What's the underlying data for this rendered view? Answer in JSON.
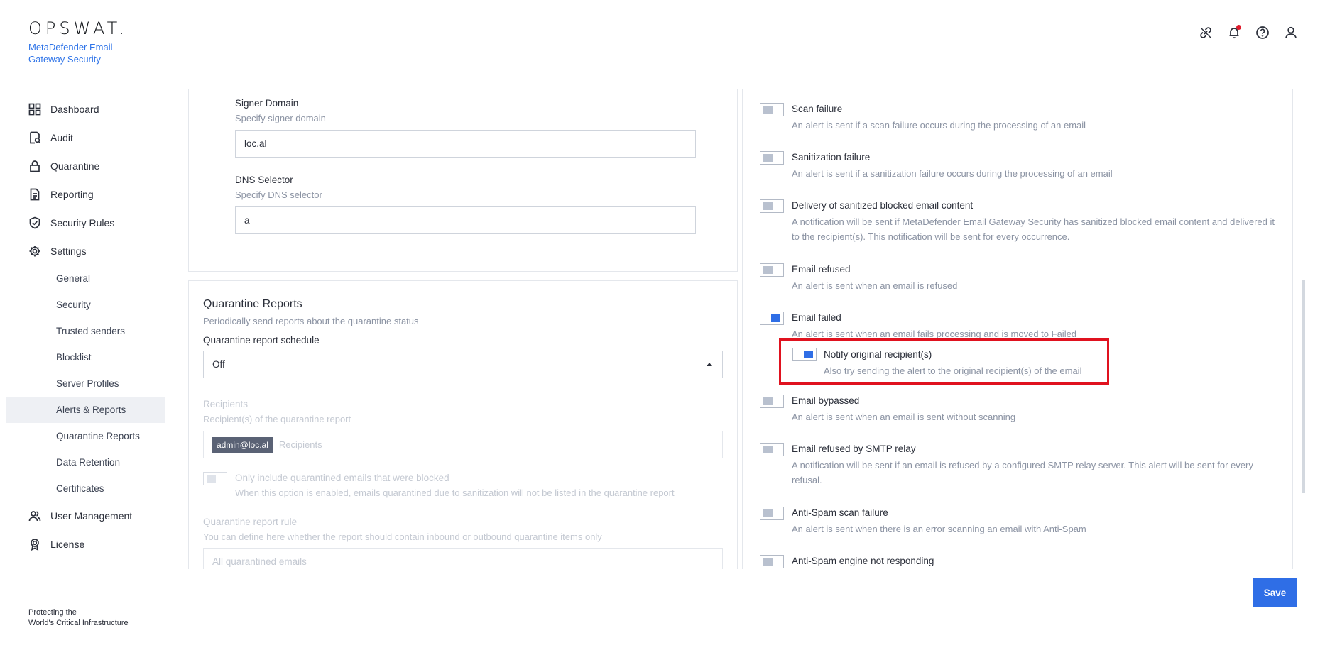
{
  "brand": {
    "logo": "OPSWAT.",
    "product": "MetaDefender Email Gateway Security"
  },
  "header_icons": [
    "link-icon",
    "bell-icon",
    "help-icon",
    "user-icon"
  ],
  "sidebar": {
    "items": [
      {
        "label": "Dashboard",
        "icon": "dashboard-icon"
      },
      {
        "label": "Audit",
        "icon": "audit-icon"
      },
      {
        "label": "Quarantine",
        "icon": "lock-icon"
      },
      {
        "label": "Reporting",
        "icon": "document-icon"
      },
      {
        "label": "Security Rules",
        "icon": "shield-icon"
      },
      {
        "label": "Settings",
        "icon": "gear-icon"
      }
    ],
    "settings_sub": [
      "General",
      "Security",
      "Trusted senders",
      "Blocklist",
      "Server Profiles",
      "Alerts & Reports",
      "Quarantine Reports",
      "Data Retention",
      "Certificates"
    ],
    "active_sub": "Alerts & Reports",
    "bottom_items": [
      {
        "label": "User Management",
        "icon": "users-icon"
      },
      {
        "label": "License",
        "icon": "award-icon"
      }
    ],
    "footer_line1": "Protecting the",
    "footer_line2": "World's Critical Infrastructure"
  },
  "dkim": {
    "signer_domain_label": "Signer Domain",
    "signer_domain_hint": "Specify signer domain",
    "signer_domain_value": "loc.al",
    "dns_selector_label": "DNS Selector",
    "dns_selector_hint": "Specify DNS selector",
    "dns_selector_value": "a"
  },
  "quarantine_reports": {
    "title": "Quarantine Reports",
    "subtitle": "Periodically send reports about the quarantine status",
    "schedule_label": "Quarantine report schedule",
    "schedule_value": "Off",
    "recipients_label": "Recipients",
    "recipients_hint": "Recipient(s) of the quarantine report",
    "recipient_chip": "admin@loc.al",
    "recipients_placeholder": "Recipients",
    "only_blocked_label": "Only include quarantined emails that were blocked",
    "only_blocked_desc": "When this option is enabled, emails quarantined due to sanitization will not be listed in the quarantine report",
    "rule_label": "Quarantine report rule",
    "rule_hint": "You can define here whether the report should contain inbound or outbound quarantine items only",
    "rule_value": "All quarantined emails"
  },
  "alerts": [
    {
      "title": "Scan failure",
      "desc": "An alert is sent if a scan failure occurs during the processing of an email",
      "enabled": false
    },
    {
      "title": "Sanitization failure",
      "desc": "An alert is sent if a sanitization failure occurs during the processing of an email",
      "enabled": false
    },
    {
      "title": "Delivery of sanitized blocked email content",
      "desc": "A notification will be sent if MetaDefender Email Gateway Security has sanitized blocked email content and delivered it to the recipient(s). This notification will be sent for every occurrence.",
      "enabled": false
    },
    {
      "title": "Email refused",
      "desc": "An alert is sent when an email is refused",
      "enabled": false
    },
    {
      "title": "Email failed",
      "desc": "An alert is sent when an email fails processing and is moved to Failed",
      "enabled": true
    },
    {
      "title": "Email bypassed",
      "desc": "An alert is sent when an email is sent without scanning",
      "enabled": false
    },
    {
      "title": "Email refused by SMTP relay",
      "desc": "A notification will be sent if an email is refused by a configured SMTP relay server. This alert will be sent for every refusal.",
      "enabled": false
    },
    {
      "title": "Anti-Spam scan failure",
      "desc": "An alert is sent when there is an error scanning an email with Anti-Spam",
      "enabled": false
    },
    {
      "title": "Anti-Spam engine not responding",
      "desc": "",
      "enabled": false
    }
  ],
  "sub_alert": {
    "title": "Notify original recipient(s)",
    "desc": "Also try sending the alert to the original recipient(s) of the email",
    "enabled": true
  },
  "actions": {
    "save_label": "Save"
  }
}
